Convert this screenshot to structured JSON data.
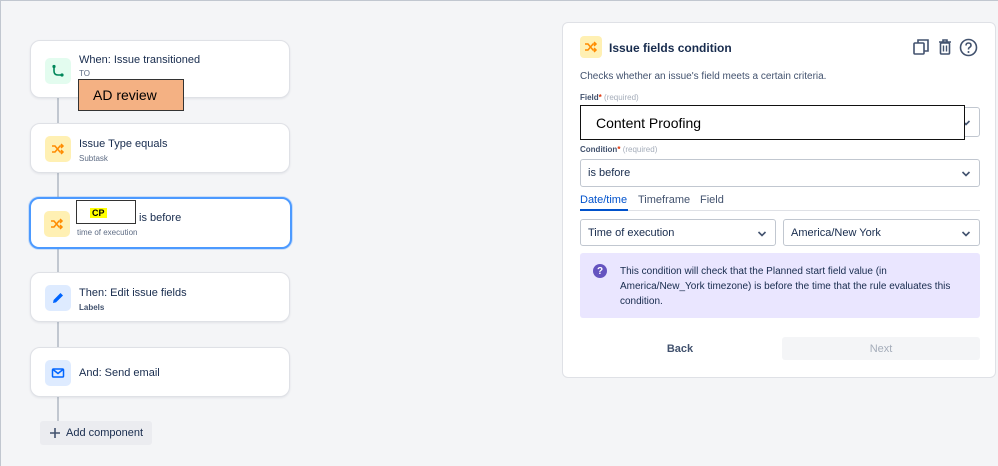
{
  "flow": {
    "trigger": {
      "title": "When: Issue transitioned",
      "sub": "TO",
      "status_overlay": "AD review"
    },
    "condition1": {
      "title": "Issue Type equals",
      "sub": "Subtask"
    },
    "condition2": {
      "overlay_text": "CP",
      "title": "is before",
      "sub": "time of execution"
    },
    "action1": {
      "title": "Then: Edit issue fields",
      "sub": "Labels"
    },
    "action2": {
      "title": "And: Send email"
    },
    "add_component": "Add component"
  },
  "panel": {
    "title": "Issue fields condition",
    "description": "Checks whether an issue's field meets a certain criteria.",
    "field_label": "Field",
    "field_required": "(required)",
    "field_value": "Content Proofing",
    "condition_label": "Condition",
    "condition_required": "(required)",
    "condition_value": "is before",
    "tabs": [
      "Date/time",
      "Timeframe",
      "Field"
    ],
    "time_select": "Time of execution",
    "timezone_select": "America/New York",
    "info": "This condition will check that the Planned start field value (in America/New_York timezone) is before the time that the rule evaluates this condition.",
    "back": "Back",
    "next": "Next"
  },
  "icons": {
    "trigger": "branch-icon",
    "condition": "shuffle-icon",
    "edit": "pencil-icon",
    "email": "mail-icon",
    "copy": "copy-icon",
    "delete": "trash-icon",
    "help": "help-icon",
    "info": "question-icon"
  },
  "colors": {
    "primary": "#0052cc",
    "selected_border": "#4c9aff",
    "info_bg": "#eae6ff",
    "status_overlay": "#f4b183",
    "highlight": "#ffff00"
  }
}
